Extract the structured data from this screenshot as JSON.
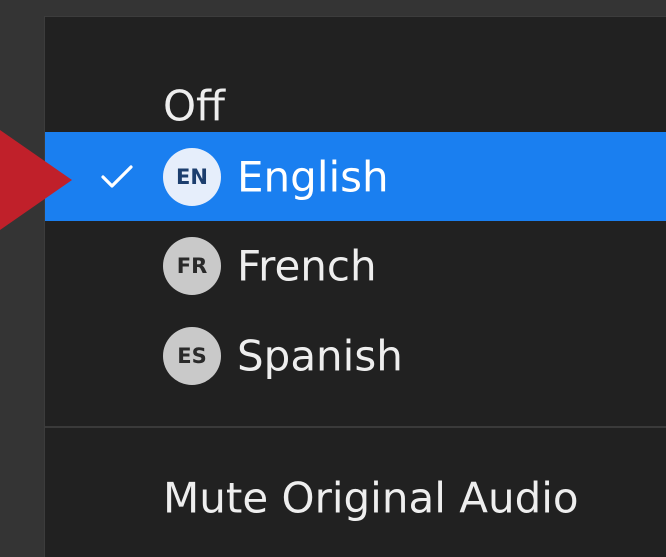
{
  "menu": {
    "items": [
      {
        "label": "Off",
        "badge": "",
        "selected": false
      },
      {
        "label": "English",
        "badge": "EN",
        "selected": true
      },
      {
        "label": "French",
        "badge": "FR",
        "selected": false
      },
      {
        "label": "Spanish",
        "badge": "ES",
        "selected": false
      }
    ],
    "mute_label": "Mute Original Audio"
  },
  "colors": {
    "selected_bg": "#1a7ff0",
    "menu_bg": "#212121",
    "pointer_arrow": "#c0202a"
  },
  "icons": {
    "selected_marker": "checkmark-icon",
    "pointer": "red-arrow-pointer"
  }
}
